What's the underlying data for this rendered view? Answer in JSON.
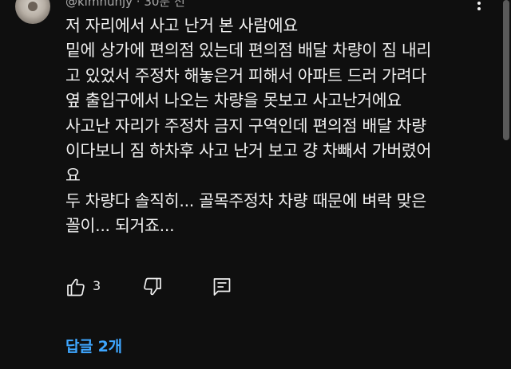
{
  "comment": {
    "meta_text": "@kimhunjy · 30분 전",
    "lines": [
      "저 자리에서 사고 난거 본 사람에요",
      "밑에 상가에 편의점 있는데 편의점 배달 차량이 짐 내리",
      "고 있었서 주정차 해놓은거 피해서 아파트 드러 가려다",
      "옆  출입구에서 나오는 차량을 못보고 사고난거에요",
      "사고난 자리가 주정차 금지 구역인데 편의점 배달 차량",
      "이다보니 짐 하차후 사고 난거 보고 걍 차빼서 가버렸어",
      "요",
      "두 차량다 솔직히... 골목주정차 차량 때문에 벼락 맞은",
      "꼴이... 되거죠..."
    ],
    "like_count": "3",
    "replies_label": "답글 2개"
  },
  "icons": {
    "menu": "more-vert-icon",
    "like": "thumbs-up-icon",
    "dislike": "thumbs-down-icon",
    "reply": "comment-icon"
  },
  "colors": {
    "background": "#0f0f0f",
    "text": "#f1f1f1",
    "secondary_text": "#aaaaaa",
    "link": "#3ea6ff"
  }
}
